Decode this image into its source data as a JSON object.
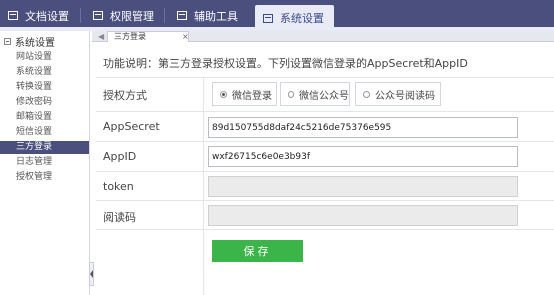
{
  "top_nav": {
    "tabs": [
      {
        "label": "文档设置",
        "icon": "document-icon"
      },
      {
        "label": "权限管理",
        "icon": "user-icon"
      },
      {
        "label": "辅助工具",
        "icon": "tools-icon"
      },
      {
        "label": "系统设置",
        "icon": "settings-icon",
        "active": true
      }
    ]
  },
  "sidebar": {
    "title": "系统设置",
    "items": [
      {
        "label": "网站设置"
      },
      {
        "label": "系统设置"
      },
      {
        "label": "转换设置"
      },
      {
        "label": "修改密码"
      },
      {
        "label": "邮箱设置"
      },
      {
        "label": "短信设置"
      },
      {
        "label": "三方登录",
        "active": true
      },
      {
        "label": "日志管理"
      },
      {
        "label": "授权管理"
      }
    ]
  },
  "page_tabs": [
    {
      "label": "三方登录",
      "close": "×"
    }
  ],
  "form": {
    "description": "功能说明：第三方登录授权设置。下列设置微信登录的AppSecret和AppID",
    "auth_method": {
      "label": "授权方式",
      "options": [
        "微信登录",
        "微信公众号",
        "公众号阅读码"
      ],
      "selected": "微信登录"
    },
    "app_secret": {
      "label": "AppSecret",
      "value": "89d150755d8daf24c5216de75376e595"
    },
    "app_id": {
      "label": "AppID",
      "value": "wxf26715c6e0e3b93f"
    },
    "token": {
      "label": "token",
      "value": ""
    },
    "read_code": {
      "label": "阅读码",
      "value": ""
    },
    "save_label": "保存"
  },
  "colors": {
    "nav_bg": "#4a4f7e",
    "active_sidebar": "#4a4f7e",
    "save_button": "#3bb54a",
    "disabled_field": "#ebebeb"
  }
}
